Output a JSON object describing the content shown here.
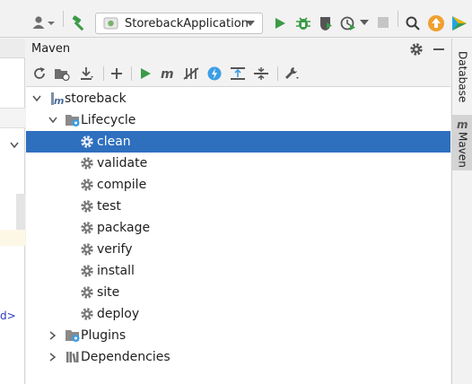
{
  "toolbar": {
    "run_config": "StorebackApplication"
  },
  "panel": {
    "title": "Maven"
  },
  "editor_strip": {
    "fragment": "d>"
  },
  "tree": {
    "project": "storeback",
    "lifecycle": "Lifecycle",
    "phases": [
      "clean",
      "validate",
      "compile",
      "test",
      "package",
      "verify",
      "install",
      "site",
      "deploy"
    ],
    "plugins": "Plugins",
    "dependencies": "Dependencies",
    "selected": "clean"
  },
  "right_tabs": {
    "database": "Database",
    "maven": "Maven"
  },
  "colors": {
    "selection": "#2e6fbe",
    "run_green": "#3c9b47",
    "update_orange": "#f0a030"
  }
}
